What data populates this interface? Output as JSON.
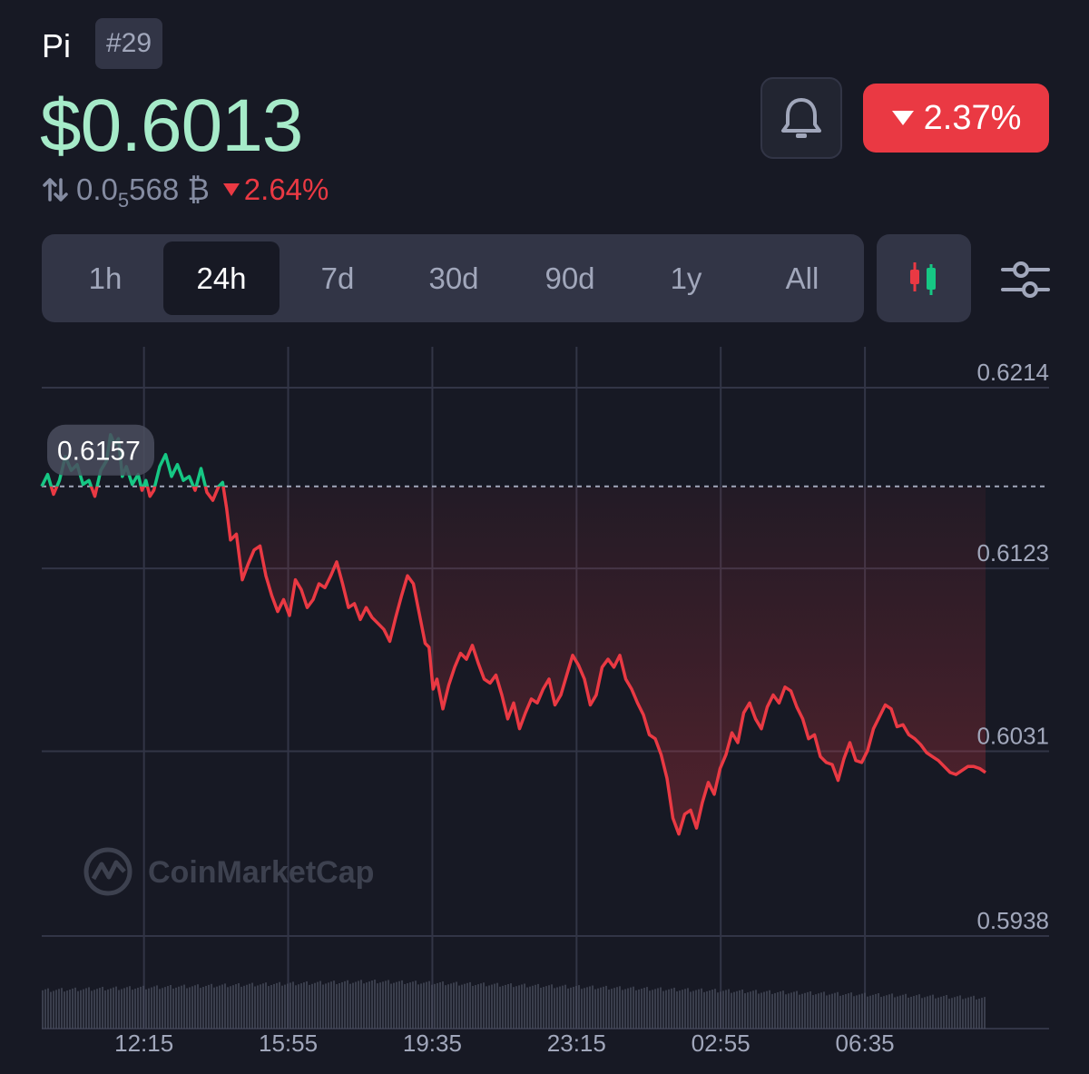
{
  "header": {
    "coin_name": "Pi",
    "rank": "#29",
    "price": "$0.6013",
    "btc_price_prefix": "0.0",
    "btc_price_sub": "5",
    "btc_price_suffix": "568",
    "btc_symbol": "₿",
    "btc_change": "2.64%",
    "change_24h": "2.37%",
    "change_direction": "down"
  },
  "icons": {
    "swap": "swap-arrows-icon",
    "bell": "bell-icon",
    "candles": "candlestick-icon",
    "filter": "sliders-icon",
    "logo": "coinmarketcap-logo-icon"
  },
  "tabs": [
    {
      "label": "1h",
      "active": false
    },
    {
      "label": "24h",
      "active": true
    },
    {
      "label": "7d",
      "active": false
    },
    {
      "label": "30d",
      "active": false
    },
    {
      "label": "90d",
      "active": false
    },
    {
      "label": "1y",
      "active": false
    },
    {
      "label": "All",
      "active": false
    }
  ],
  "colors": {
    "up": "#16c784",
    "down": "#ea3943",
    "price": "#a6ebc9",
    "background": "#171924"
  },
  "watermark": "CoinMarketCap",
  "chart_data": {
    "type": "line",
    "open_reference": 0.6157,
    "open_label": "0.6157",
    "ylim": [
      0.5911,
      0.6227
    ],
    "yticks": [
      "0.6214",
      "0.6123",
      "0.6031",
      "0.5938"
    ],
    "ytick_values": [
      0.6214,
      0.6123,
      0.6031,
      0.5938
    ],
    "xticks": [
      "12:15",
      "15:55",
      "19:35",
      "23:15",
      "02:55",
      "06:35"
    ],
    "xlim_hours": [
      0,
      24
    ],
    "xtick_hours": [
      2.6,
      6.266,
      9.933,
      13.6,
      17.266,
      20.933
    ],
    "points": [
      [
        0.0,
        0.6157
      ],
      [
        0.15,
        0.6163
      ],
      [
        0.3,
        0.6153
      ],
      [
        0.45,
        0.616
      ],
      [
        0.6,
        0.6172
      ],
      [
        0.75,
        0.6165
      ],
      [
        0.9,
        0.6168
      ],
      [
        1.05,
        0.6158
      ],
      [
        1.2,
        0.616
      ],
      [
        1.35,
        0.6152
      ],
      [
        1.5,
        0.6165
      ],
      [
        1.65,
        0.617
      ],
      [
        1.75,
        0.6183
      ],
      [
        1.85,
        0.6178
      ],
      [
        1.95,
        0.6181
      ],
      [
        2.05,
        0.6162
      ],
      [
        2.15,
        0.6167
      ],
      [
        2.3,
        0.6158
      ],
      [
        2.45,
        0.6163
      ],
      [
        2.55,
        0.6155
      ],
      [
        2.65,
        0.616
      ],
      [
        2.75,
        0.6152
      ],
      [
        2.85,
        0.6155
      ],
      [
        3.0,
        0.6167
      ],
      [
        3.15,
        0.6173
      ],
      [
        3.3,
        0.6162
      ],
      [
        3.45,
        0.6168
      ],
      [
        3.6,
        0.616
      ],
      [
        3.75,
        0.6162
      ],
      [
        3.9,
        0.6155
      ],
      [
        4.05,
        0.6166
      ],
      [
        4.2,
        0.6154
      ],
      [
        4.35,
        0.615
      ],
      [
        4.5,
        0.6157
      ],
      [
        4.6,
        0.6159
      ],
      [
        4.7,
        0.6146
      ],
      [
        4.8,
        0.613
      ],
      [
        4.95,
        0.6133
      ],
      [
        5.1,
        0.611
      ],
      [
        5.25,
        0.6118
      ],
      [
        5.4,
        0.6125
      ],
      [
        5.55,
        0.6127
      ],
      [
        5.7,
        0.6112
      ],
      [
        5.85,
        0.6102
      ],
      [
        6.0,
        0.6094
      ],
      [
        6.15,
        0.61
      ],
      [
        6.3,
        0.6092
      ],
      [
        6.45,
        0.611
      ],
      [
        6.6,
        0.6105
      ],
      [
        6.75,
        0.6096
      ],
      [
        6.9,
        0.61
      ],
      [
        7.05,
        0.6108
      ],
      [
        7.2,
        0.6106
      ],
      [
        7.35,
        0.6112
      ],
      [
        7.5,
        0.6119
      ],
      [
        7.65,
        0.6108
      ],
      [
        7.8,
        0.6096
      ],
      [
        7.95,
        0.6098
      ],
      [
        8.1,
        0.609
      ],
      [
        8.25,
        0.6096
      ],
      [
        8.4,
        0.6091
      ],
      [
        8.55,
        0.6088
      ],
      [
        8.7,
        0.6085
      ],
      [
        8.85,
        0.6079
      ],
      [
        9.0,
        0.6091
      ],
      [
        9.15,
        0.6102
      ],
      [
        9.3,
        0.6112
      ],
      [
        9.45,
        0.6108
      ],
      [
        9.6,
        0.6093
      ],
      [
        9.75,
        0.6078
      ],
      [
        9.85,
        0.6076
      ],
      [
        9.95,
        0.6055
      ],
      [
        10.05,
        0.606
      ],
      [
        10.2,
        0.6045
      ],
      [
        10.35,
        0.6057
      ],
      [
        10.5,
        0.6066
      ],
      [
        10.65,
        0.6073
      ],
      [
        10.8,
        0.607
      ],
      [
        10.95,
        0.6077
      ],
      [
        11.1,
        0.6068
      ],
      [
        11.25,
        0.606
      ],
      [
        11.4,
        0.6058
      ],
      [
        11.55,
        0.6062
      ],
      [
        11.7,
        0.6052
      ],
      [
        11.85,
        0.604
      ],
      [
        12.0,
        0.6048
      ],
      [
        12.15,
        0.6035
      ],
      [
        12.3,
        0.6043
      ],
      [
        12.45,
        0.605
      ],
      [
        12.6,
        0.6048
      ],
      [
        12.75,
        0.6055
      ],
      [
        12.9,
        0.606
      ],
      [
        13.05,
        0.6047
      ],
      [
        13.2,
        0.6052
      ],
      [
        13.35,
        0.6062
      ],
      [
        13.5,
        0.6072
      ],
      [
        13.65,
        0.6067
      ],
      [
        13.8,
        0.606
      ],
      [
        13.95,
        0.6047
      ],
      [
        14.1,
        0.6052
      ],
      [
        14.25,
        0.6066
      ],
      [
        14.4,
        0.607
      ],
      [
        14.55,
        0.6066
      ],
      [
        14.7,
        0.6072
      ],
      [
        14.85,
        0.606
      ],
      [
        15.0,
        0.6055
      ],
      [
        15.15,
        0.6048
      ],
      [
        15.3,
        0.6042
      ],
      [
        15.45,
        0.6032
      ],
      [
        15.6,
        0.603
      ],
      [
        15.75,
        0.6022
      ],
      [
        15.9,
        0.601
      ],
      [
        16.05,
        0.599
      ],
      [
        16.2,
        0.5982
      ],
      [
        16.35,
        0.5992
      ],
      [
        16.5,
        0.5994
      ],
      [
        16.65,
        0.5985
      ],
      [
        16.8,
        0.5998
      ],
      [
        16.95,
        0.6008
      ],
      [
        17.1,
        0.6002
      ],
      [
        17.25,
        0.6015
      ],
      [
        17.4,
        0.6022
      ],
      [
        17.55,
        0.6033
      ],
      [
        17.7,
        0.6028
      ],
      [
        17.85,
        0.6043
      ],
      [
        18.0,
        0.6048
      ],
      [
        18.15,
        0.604
      ],
      [
        18.3,
        0.6035
      ],
      [
        18.45,
        0.6046
      ],
      [
        18.6,
        0.6052
      ],
      [
        18.75,
        0.6048
      ],
      [
        18.9,
        0.6056
      ],
      [
        19.05,
        0.6054
      ],
      [
        19.2,
        0.6046
      ],
      [
        19.35,
        0.604
      ],
      [
        19.5,
        0.603
      ],
      [
        19.65,
        0.6032
      ],
      [
        19.8,
        0.6021
      ],
      [
        19.95,
        0.6018
      ],
      [
        20.1,
        0.6017
      ],
      [
        20.25,
        0.6009
      ],
      [
        20.4,
        0.602
      ],
      [
        20.55,
        0.6028
      ],
      [
        20.7,
        0.6019
      ],
      [
        20.85,
        0.6018
      ],
      [
        21.0,
        0.6024
      ],
      [
        21.15,
        0.6035
      ],
      [
        21.3,
        0.6041
      ],
      [
        21.45,
        0.6047
      ],
      [
        21.6,
        0.6045
      ],
      [
        21.75,
        0.6036
      ],
      [
        21.9,
        0.6037
      ],
      [
        22.05,
        0.6032
      ],
      [
        22.2,
        0.603
      ],
      [
        22.35,
        0.6027
      ],
      [
        22.5,
        0.6023
      ],
      [
        22.65,
        0.6021
      ],
      [
        22.8,
        0.6019
      ],
      [
        22.95,
        0.6016
      ],
      [
        23.1,
        0.6013
      ],
      [
        23.25,
        0.6012
      ],
      [
        23.4,
        0.6014
      ],
      [
        23.55,
        0.6016
      ],
      [
        23.7,
        0.6016
      ],
      [
        23.85,
        0.6015
      ],
      [
        24.0,
        0.6013
      ]
    ],
    "xlabel": "",
    "ylabel": "",
    "grid": true
  }
}
